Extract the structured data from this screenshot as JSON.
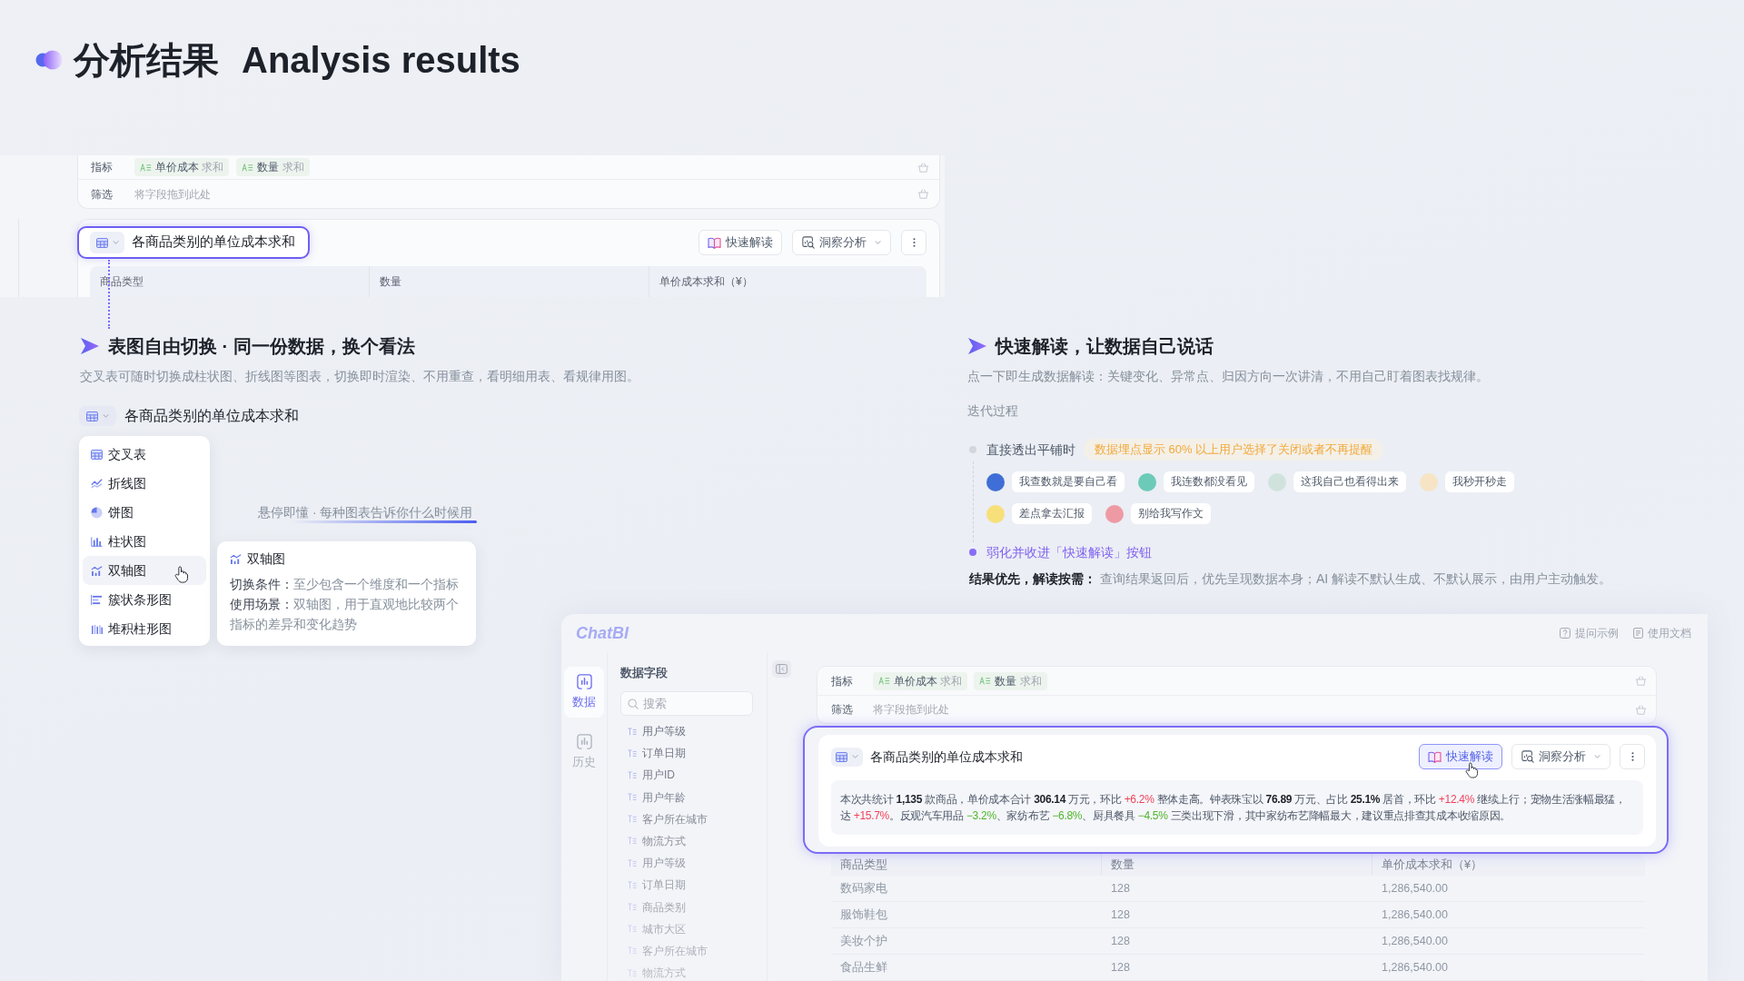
{
  "header": {
    "title": "分析结果",
    "subtitle": "Analysis results"
  },
  "top_preview": {
    "metrics_label": "指标",
    "metrics": [
      {
        "name": "单价成本",
        "aggregation": "求和"
      },
      {
        "name": "数量",
        "aggregation": "求和"
      }
    ],
    "filter_label": "筛选",
    "filter_placeholder": "将字段拖到此处",
    "card_title": "各商品类别的单位成本求和",
    "actions": [
      {
        "kind": "interpret",
        "label": "快速解读",
        "active": false
      },
      {
        "kind": "insight",
        "label": "洞察分析",
        "active": false
      },
      {
        "kind": "more",
        "active": false
      }
    ],
    "columns": [
      "商品类型",
      "数量",
      "单价成本求和（¥）"
    ]
  },
  "chart_switch": {
    "heading": "表图自由切换 · 同一份数据，换个看法",
    "description": "交叉表可随时切换成柱状图、折线图等图表，切换即时渲染、不用重查，看明细用表、看规律用图。",
    "card_title": "各商品类别的单位成本求和",
    "chart_types": [
      {
        "kind": "table",
        "label": "交叉表",
        "selected": false
      },
      {
        "kind": "line",
        "label": "折线图",
        "selected": false
      },
      {
        "kind": "pie",
        "label": "饼图",
        "selected": false
      },
      {
        "kind": "bar",
        "label": "柱状图",
        "selected": false
      },
      {
        "kind": "dual_axis",
        "label": "双轴图",
        "selected": true
      },
      {
        "kind": "cluster_bar",
        "label": "簇状条形图",
        "selected": false
      },
      {
        "kind": "stacked_column",
        "label": "堆积柱形图",
        "selected": false
      }
    ],
    "hover_caption": "悬停即懂 · 每种图表告诉你什么时候用",
    "tooltip": {
      "kind": "dual_axis",
      "title": "双轴图",
      "lines": [
        "**切换条件：**至少包含一个维度和一个指标",
        "**使用场景：**双轴图，用于直观地比较两个指标的差异和变化趋势"
      ]
    }
  },
  "quick_insight": {
    "heading": "快速解读，让数据自己说话",
    "description": "点一下即生成数据解读：关键变化、异常点、归因方向一次讲清，不用自己盯着图表找规律。",
    "process_label": "迭代过程",
    "steps": [
      {
        "kind": "past",
        "title": "直接透出平铺时",
        "note": "数据埋点显示 60% 以上用户选择了关闭或者不再提醒",
        "comments": [
          {
            "text": "我查数就是要自己看",
            "color": "#3f6fd6"
          },
          {
            "text": "我连数都没看见",
            "color": "#6ccab8"
          },
          {
            "text": "这我自己也看得出来",
            "color": "#cfe3dc"
          },
          {
            "text": "我秒开秒走",
            "color": "#f6e4c4"
          },
          {
            "text": "差点拿去汇报",
            "color": "#f7df7a"
          },
          {
            "text": "别给我写作文",
            "color": "#ee9aa4"
          }
        ]
      },
      {
        "kind": "current",
        "title": "弱化并收进「快速解读」按钮"
      }
    ],
    "conclusion": "**结果优先，解读按需：** 查询结果返回后，优先呈现数据本身；AI 解读不默认生成、不默认展示，由用户主动触发。"
  },
  "chatbi": {
    "logo": "ChatBI",
    "links": [
      {
        "kind": "help",
        "label": "提问示例"
      },
      {
        "kind": "doc",
        "label": "使用文档"
      }
    ],
    "nav": [
      {
        "label": "数据",
        "selected": true
      },
      {
        "label": "历史",
        "selected": false
      }
    ],
    "fields_title": "数据字段",
    "search_placeholder": "搜索",
    "fields": [
      "用户等级",
      "订单日期",
      "用户ID",
      "用户年龄",
      "客户所在城市",
      "物流方式",
      "用户等级",
      "订单日期",
      "商品类别",
      "城市大区",
      "客户所在城市",
      "物流方式"
    ],
    "metrics_label": "指标",
    "metrics": [
      {
        "name": "单价成本",
        "aggregation": "求和"
      },
      {
        "name": "数量",
        "aggregation": "求和"
      }
    ],
    "filter_label": "筛选",
    "filter_placeholder": "将字段拖到此处",
    "card_title": "各商品类别的单位成本求和",
    "actions": [
      {
        "kind": "interpret",
        "label": "快速解读",
        "active": true
      },
      {
        "kind": "insight",
        "label": "洞察分析",
        "active": false
      },
      {
        "kind": "more",
        "active": false
      }
    ],
    "summary": [
      {
        "kind": "plain",
        "text": "本次共统计 **1,135** 款商品，单价成本合计 **306.14** 万元，环比 "
      },
      {
        "kind": "up",
        "text": "+6.2%"
      },
      {
        "kind": "plain",
        "text": " 整体走高。钟表珠宝以 **76.89** 万元、占比 **25.1%** 居首，环比 "
      },
      {
        "kind": "up",
        "text": "+12.4%"
      },
      {
        "kind": "plain",
        "text": " 继续上行；宠物生活涨幅最猛，达 "
      },
      {
        "kind": "up",
        "text": "+15.7%"
      },
      {
        "kind": "plain",
        "text": "。反观汽车用品 "
      },
      {
        "kind": "down",
        "text": "−3.2%"
      },
      {
        "kind": "plain",
        "text": "、家纺布艺 "
      },
      {
        "kind": "down",
        "text": "−6.8%"
      },
      {
        "kind": "plain",
        "text": "、厨具餐具 "
      },
      {
        "kind": "down",
        "text": "−4.5%"
      },
      {
        "kind": "plain",
        "text": " 三类出现下滑，其中家纺布艺降幅最大，建议重点排查其成本收缩原因。"
      }
    ],
    "columns": [
      "商品类型",
      "数量",
      "单价成本求和（¥）"
    ],
    "rows": [
      [
        "数码家电",
        "128",
        "1,286,540.00"
      ],
      [
        "服饰鞋包",
        "128",
        "1,286,540.00"
      ],
      [
        "美妆个护",
        "128",
        "1,286,540.00"
      ],
      [
        "食品生鲜",
        "128",
        "1,286,540.00"
      ]
    ]
  }
}
